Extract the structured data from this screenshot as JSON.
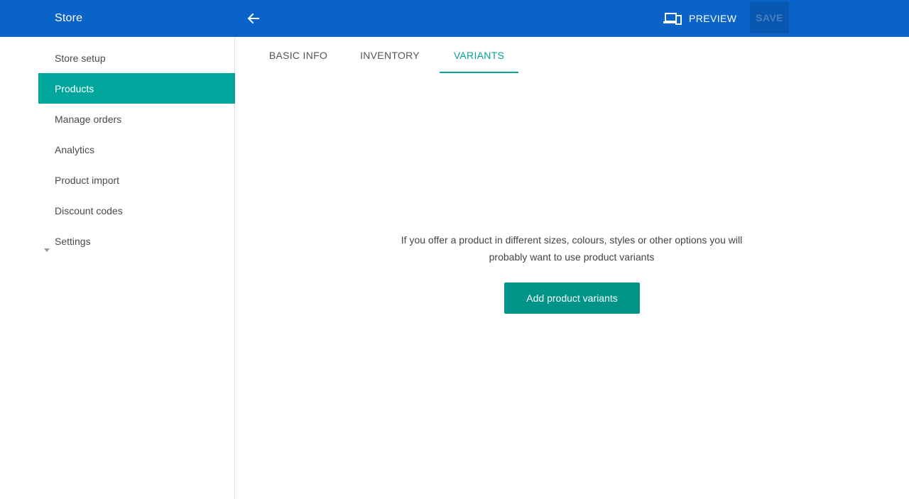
{
  "topbar": {
    "app_title": "Store",
    "back_icon": "arrow-left-icon",
    "preview_label": "PREVIEW",
    "preview_icon": "devices-icon",
    "save_label": "SAVE",
    "color": "#0a63c8"
  },
  "sidebar": {
    "items": [
      {
        "label": "Store setup"
      },
      {
        "label": "Products",
        "active": true
      },
      {
        "label": "Manage orders"
      },
      {
        "label": "Analytics"
      },
      {
        "label": "Product import"
      },
      {
        "label": "Discount codes"
      },
      {
        "label": "Settings",
        "expandable": true
      }
    ],
    "accent": "#00a59b"
  },
  "tabs": [
    {
      "label": "BASIC INFO"
    },
    {
      "label": "INVENTORY"
    },
    {
      "label": "VARIANTS",
      "active": true
    }
  ],
  "main": {
    "message_line1": "If you offer a product in different sizes, colours, styles or other options you will",
    "message_line2": "probably want to use product variants",
    "add_button_label": "Add product variants"
  }
}
